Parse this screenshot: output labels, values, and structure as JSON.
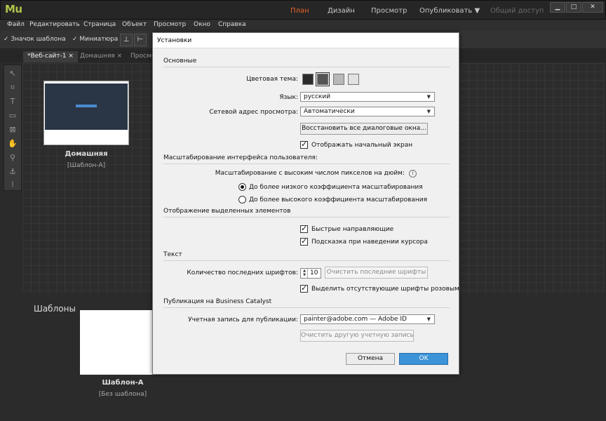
{
  "app": {
    "logo": "Mu",
    "nav": [
      "План",
      "Дизайн",
      "Просмотр",
      "Опубликовать ▼",
      "Общий доступ"
    ],
    "window_controls": [
      "▁",
      "□",
      "✕"
    ]
  },
  "menu": [
    "Файл",
    "Редактировать",
    "Страница",
    "Объект",
    "Просмотр",
    "Окно",
    "Справка"
  ],
  "toolbar": {
    "template_icon_check": "Значок шаблона",
    "thumbnail_check": "Миниатюра"
  },
  "tabs": [
    {
      "label": "*Веб-сайт-1 ×"
    },
    {
      "label": "Домашняя ×"
    },
    {
      "label": "Просмо"
    }
  ],
  "pages": {
    "home_name": "Домашняя",
    "home_master": "[Шаблон-А]",
    "templates_title": "Шаблоны",
    "template_name": "Шаблон-А",
    "template_master": "[Без шаблона]"
  },
  "dialog": {
    "title": "Установки",
    "general": {
      "section": "Основные",
      "color_theme_label": "Цветовая тема:",
      "color_theme_swatches": [
        "#2b2b2b",
        "#555555",
        "#b8b8b8",
        "#e2e2e2"
      ],
      "language_label": "Язык:",
      "language_value": "русский",
      "preview_address_label": "Сетевой адрес просмотра:",
      "preview_address_value": "Автоматически",
      "reset_dialogs_button": "Восстановить все диалоговые окна...",
      "show_welcome_check": "Отображать начальный экран"
    },
    "scaling": {
      "section": "Масштабирование интерфейса пользователя:",
      "hidpi_label": "Масштабирование с высоким числом пикселов на дюйм:",
      "info_icon": "i",
      "option_low": "До более низкого коэффициента масштабирования",
      "option_high": "До более высокого коэффициента масштабирования"
    },
    "selection": {
      "section": "Отображение выделенных элементов",
      "smart_guides_check": "Быстрые направляющие",
      "hover_hint_check": "Подсказка при наведении курсора"
    },
    "text": {
      "section": "Текст",
      "recent_fonts_label": "Количество последних шрифтов:",
      "recent_fonts_value": "10",
      "clear_recent_fonts_button": "Очистить последние шрифты",
      "highlight_missing_fonts_check": "Выделить отсутствующие шрифты розовым"
    },
    "publishing": {
      "section": "Публикация на Business Catalyst",
      "account_label": "Учетная запись для публикации:",
      "account_value": "painter@adobe.com — Adobe ID",
      "clear_account_button": "Очистить другую учетную запись"
    },
    "cancel_button": "Отмена",
    "ok_button": "OK"
  }
}
